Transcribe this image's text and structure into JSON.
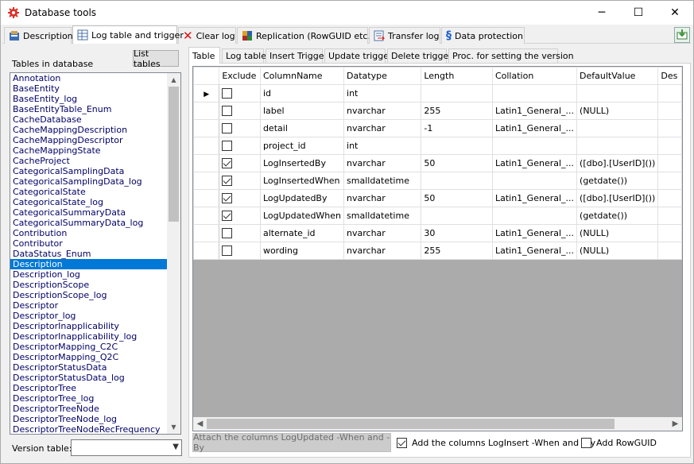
{
  "window": {
    "title": "Database tools",
    "minimize_glyph": "─",
    "maximize_glyph": "☐",
    "close_glyph": "✕"
  },
  "main_tabs": [
    {
      "label": "Description",
      "icon": "description-icon",
      "active": false
    },
    {
      "label": "Log table and trigger",
      "icon": "log-table-icon",
      "active": true
    },
    {
      "label": "Clear log",
      "icon": "red-x-icon",
      "active": false
    },
    {
      "label": "Replication (RowGUID etc.)",
      "icon": "replication-icon",
      "active": false
    },
    {
      "label": "Transfer log",
      "icon": "transfer-log-icon",
      "active": false
    },
    {
      "label": "Data protection",
      "icon": "section-sign-icon",
      "active": false
    }
  ],
  "left": {
    "label": "Tables in database",
    "list_tables_button": "List tables",
    "tables": [
      "Annotation",
      "BaseEntity",
      "BaseEntity_log",
      "BaseEntityTable_Enum",
      "CacheDatabase",
      "CacheMappingDescription",
      "CacheMappingDescriptor",
      "CacheMappingState",
      "CacheProject",
      "CategoricalSamplingData",
      "CategoricalSamplingData_log",
      "CategoricalState",
      "CategoricalState_log",
      "CategoricalSummaryData",
      "CategoricalSummaryData_log",
      "Contribution",
      "Contributor",
      "DataStatus_Enum",
      "Description",
      "Description_log",
      "DescriptionScope",
      "DescriptionScope_log",
      "Descriptor",
      "Descriptor_log",
      "DescriptorInapplicability",
      "DescriptorInapplicability_log",
      "DescriptorMapping_C2C",
      "DescriptorMapping_Q2C",
      "DescriptorStatusData",
      "DescriptorStatusData_log",
      "DescriptorTree",
      "DescriptorTree_log",
      "DescriptorTreeNode",
      "DescriptorTreeNode_log",
      "DescriptorTreeNodeRecFrequency"
    ],
    "selected_table": "Description",
    "version_label": "Version table:",
    "version_value": ""
  },
  "sub_tabs": [
    {
      "label": "Table",
      "active": true
    },
    {
      "label": "Log table",
      "active": false
    },
    {
      "label": "Insert Trigger",
      "active": false
    },
    {
      "label": "Update trigger",
      "active": false
    },
    {
      "label": "Delete trigger",
      "active": false
    },
    {
      "label": "Proc. for setting the version",
      "active": false
    }
  ],
  "grid": {
    "columns": [
      "Exclude",
      "ColumnName",
      "Datatype",
      "Length",
      "Collation",
      "DefaultValue",
      "Des"
    ],
    "current_row_marker": "▶",
    "rows": [
      {
        "exclude": false,
        "column_name": "id",
        "datatype": "int",
        "length": "",
        "collation": "",
        "default": ""
      },
      {
        "exclude": false,
        "column_name": "label",
        "datatype": "nvarchar",
        "length": "255",
        "collation": "Latin1_General_...",
        "default": "(NULL)"
      },
      {
        "exclude": false,
        "column_name": "detail",
        "datatype": "nvarchar",
        "length": "-1",
        "collation": "Latin1_General_...",
        "default": ""
      },
      {
        "exclude": false,
        "column_name": "project_id",
        "datatype": "int",
        "length": "",
        "collation": "",
        "default": ""
      },
      {
        "exclude": true,
        "column_name": "LogInsertedBy",
        "datatype": "nvarchar",
        "length": "50",
        "collation": "Latin1_General_...",
        "default": "([dbo].[UserID]())"
      },
      {
        "exclude": true,
        "column_name": "LogInsertedWhen",
        "datatype": "smalldatetime",
        "length": "",
        "collation": "",
        "default": "(getdate())"
      },
      {
        "exclude": true,
        "column_name": "LogUpdatedBy",
        "datatype": "nvarchar",
        "length": "50",
        "collation": "Latin1_General_...",
        "default": "([dbo].[UserID]())"
      },
      {
        "exclude": true,
        "column_name": "LogUpdatedWhen",
        "datatype": "smalldatetime",
        "length": "",
        "collation": "",
        "default": "(getdate())"
      },
      {
        "exclude": false,
        "column_name": "alternate_id",
        "datatype": "nvarchar",
        "length": "30",
        "collation": "Latin1_General_...",
        "default": "(NULL)"
      },
      {
        "exclude": false,
        "column_name": "wording",
        "datatype": "nvarchar",
        "length": "255",
        "collation": "Latin1_General_...",
        "default": "(NULL)"
      }
    ]
  },
  "bottom": {
    "attach_button": "Attach the columns LogUpdated -When and -By",
    "add_loginsert_label": "Add the columns LogInsert -When and -By",
    "add_loginsert_checked": true,
    "add_rowguid_label": "Add RowGUID",
    "add_rowguid_checked": false
  }
}
